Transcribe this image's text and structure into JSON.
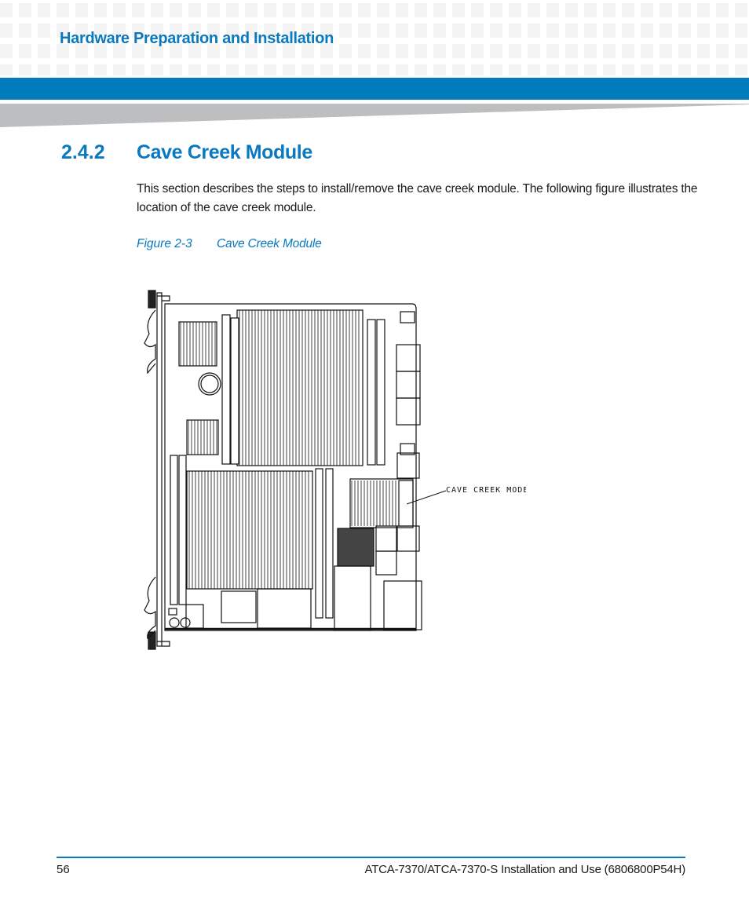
{
  "header": {
    "chapter_title": "Hardware Preparation and Installation",
    "accent_color": "#007cbd",
    "band_color": "#007cbd",
    "wedge_color": "#bdbec0"
  },
  "section": {
    "number": "2.4.2",
    "title": "Cave Creek Module",
    "body": "This section describes the steps to install/remove the cave creek module. The following figure illustrates the location of the cave creek module."
  },
  "figure": {
    "label": "Figure 2-3",
    "title": "Cave Creek Module",
    "callout": "CAVE CREEK MODEL"
  },
  "footer": {
    "page_number": "56",
    "document_title": "ATCA-7370/ATCA-7370-S Installation and Use (6806800P54H)"
  }
}
